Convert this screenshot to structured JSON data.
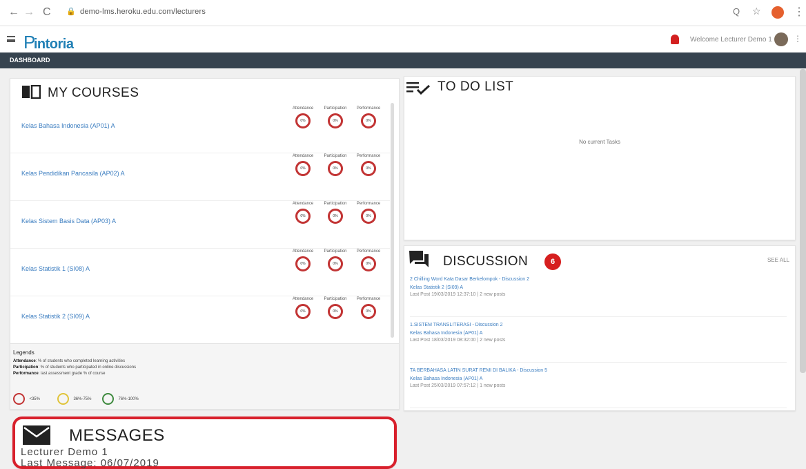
{
  "browser": {
    "url": "demo-lms.heroku.edu.com/lecturers",
    "back_label": "←",
    "forward_label": "→",
    "reload_label": "C",
    "zoom_label": "Q",
    "star_label": "☆",
    "more_label": "⋮"
  },
  "app": {
    "logo_text": "intoria",
    "logo_mark": "P",
    "welcome": "Welcome Lecturer Demo 1",
    "dashboard_label": "DASHBOARD",
    "kebab": "⋮"
  },
  "courses": {
    "title": "MY COURSES",
    "metric_labels": [
      "Attendance",
      "Participation",
      "Performance"
    ],
    "items": [
      {
        "name": "Kelas Bahasa Indonesia (AP01) A",
        "values": [
          "0%",
          "0%",
          "0%"
        ]
      },
      {
        "name": "Kelas Pendidikan Pancasila (AP02) A",
        "values": [
          "0%",
          "0%",
          "0%"
        ]
      },
      {
        "name": "Kelas Sistem Basis Data (AP03) A",
        "values": [
          "0%",
          "0%",
          "0%"
        ]
      },
      {
        "name": "Kelas Statistik 1 (SI08) A",
        "values": [
          "0%",
          "0%",
          "0%"
        ]
      },
      {
        "name": "Kelas Statistik 2 (SI09) A",
        "values": [
          "0%",
          "0%",
          "0%"
        ]
      }
    ],
    "ring_color": "#c23434"
  },
  "legend": {
    "title": "Legends",
    "lines": [
      {
        "key": "Attendance",
        "text": ": % of students who completed learning activities"
      },
      {
        "key": "Participation",
        "text": ": % of students who participated in online discussions"
      },
      {
        "key": "Performance",
        "text": ": last assessment grade % of course"
      }
    ],
    "items": [
      {
        "label": "<35%",
        "color": "#c23434"
      },
      {
        "label": "36%-75%",
        "color": "#e0c43a"
      },
      {
        "label": "76%-100%",
        "color": "#3e8a3e"
      }
    ]
  },
  "todo": {
    "title": "TO DO LIST",
    "empty": "No current Tasks"
  },
  "discussion": {
    "title": "DISCUSSION",
    "badge": "6",
    "see_all": "SEE ALL",
    "items": [
      {
        "title": "2 Chilling Word Kata Dasar Berkelompok - Discussion 2",
        "course": "Kelas Statistik 2 (SI09) A",
        "last_post": "Last Post 19/03/2019 12:37:10 | 2 new posts"
      },
      {
        "title": "1.SISTEM TRANSLITERASI - Discussion 2",
        "course": "Kelas Bahasa Indonesia (AP01) A",
        "last_post": "Last Post 18/03/2019 08:32:00 | 2 new posts"
      },
      {
        "title": "TA BERBAHASA LATIN SURAT REMI DI BALIKA - Discussion 5",
        "course": "Kelas Bahasa Indonesia (AP01) A",
        "last_post": "Last Post 25/03/2019 07:57:12 | 1 new posts"
      }
    ]
  },
  "messages": {
    "title": "MESSAGES",
    "sender": "Lecturer Demo 1",
    "last": "Last Message: 06/07/2019"
  }
}
